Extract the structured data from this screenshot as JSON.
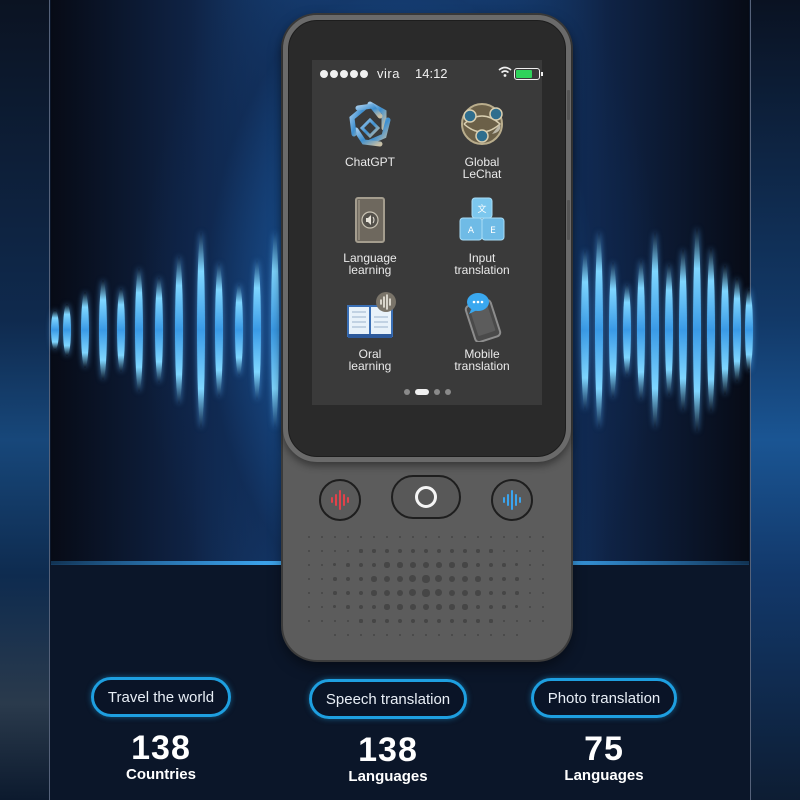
{
  "device": {
    "status_bar": {
      "signal_dots": 5,
      "carrier": "vira",
      "time": "14:12",
      "wifi_icon": "wifi-icon",
      "battery_level": 0.75,
      "battery_color": "#2ed35a"
    },
    "apps": [
      {
        "label_line1": "ChatGPT",
        "label_line2": "",
        "icon": "chatgpt-knot-icon"
      },
      {
        "label_line1": "Global",
        "label_line2": "LeChat",
        "icon": "globe-network-icon"
      },
      {
        "label_line1": "Language",
        "label_line2": "learning",
        "icon": "audio-book-icon"
      },
      {
        "label_line1": "Input",
        "label_line2": "translation",
        "icon": "keyboard-keys-icon"
      },
      {
        "label_line1": "Oral",
        "label_line2": "learning",
        "icon": "open-book-voice-icon"
      },
      {
        "label_line1": "Mobile",
        "label_line2": "translation",
        "icon": "phone-chat-icon"
      }
    ],
    "page_indicator": {
      "count": 4,
      "active_index": 1
    },
    "buttons": {
      "left": {
        "icon": "voice-wave-red-icon",
        "color": "#e2424a"
      },
      "center": {
        "icon": "home-circle-icon"
      },
      "right": {
        "icon": "voice-wave-blue-icon",
        "color": "#3aa4ee"
      }
    }
  },
  "features": [
    {
      "pill": "Travel the world",
      "number": "138",
      "unit": "Countries"
    },
    {
      "pill": "Speech translation",
      "number": "138",
      "unit": "Languages"
    },
    {
      "pill": "Photo translation",
      "number": "75",
      "unit": "Languages"
    }
  ],
  "colors": {
    "accent": "#1e9fe0",
    "wave": "#5ab8f2",
    "background": "#0b1629"
  }
}
